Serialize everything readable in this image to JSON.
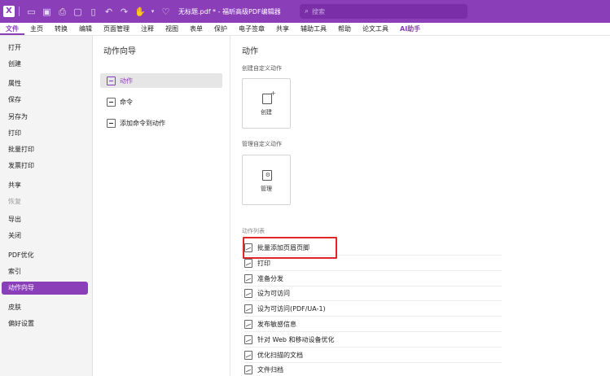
{
  "window": {
    "logo": "X",
    "title": "无标题.pdf * - 福昕高级PDF编辑器",
    "search_placeholder": "搜索"
  },
  "menu": [
    {
      "label": "文件",
      "active": true
    },
    {
      "label": "主页"
    },
    {
      "label": "转换"
    },
    {
      "label": "编辑"
    },
    {
      "label": "页面管理"
    },
    {
      "label": "注释"
    },
    {
      "label": "视图"
    },
    {
      "label": "表单"
    },
    {
      "label": "保护"
    },
    {
      "label": "电子签章"
    },
    {
      "label": "共享"
    },
    {
      "label": "辅助工具"
    },
    {
      "label": "帮助"
    },
    {
      "label": "论文工具"
    },
    {
      "label": "AI助手",
      "ai": true
    }
  ],
  "leftnav": [
    {
      "label": "打开"
    },
    {
      "label": "创建"
    },
    {
      "label": "属性"
    },
    {
      "label": "保存"
    },
    {
      "label": "另存为"
    },
    {
      "label": "打印"
    },
    {
      "label": "批量打印"
    },
    {
      "label": "发票打印"
    },
    {
      "label": "共享"
    },
    {
      "label": "恢复",
      "disabled": true
    },
    {
      "label": "导出"
    },
    {
      "label": "关闭"
    },
    {
      "label": "PDF优化"
    },
    {
      "label": "索引"
    },
    {
      "label": "动作向导",
      "active": true
    },
    {
      "label": "皮肤"
    },
    {
      "label": "偏好设置"
    }
  ],
  "middle": {
    "title": "动作向导",
    "items": [
      {
        "label": "动作",
        "active": true
      },
      {
        "label": "命令"
      },
      {
        "label": "添加命令到动作"
      }
    ]
  },
  "content": {
    "title": "动作",
    "create_section": "创建自定义动作",
    "create_card": "创建",
    "manage_section": "管理自定义动作",
    "manage_card": "管理",
    "list_section": "动作列表",
    "actions": [
      "批量添加页眉页脚",
      "打印",
      "准备分发",
      "设为可访问",
      "设为可访问(PDF/UA-1)",
      "发布敏感信息",
      "针对 Web 和移动设备优化",
      "优化扫描的文档",
      "文件归档"
    ]
  },
  "colors": {
    "accent": "#8a3fb8",
    "highlight_border": "#e0262b"
  }
}
